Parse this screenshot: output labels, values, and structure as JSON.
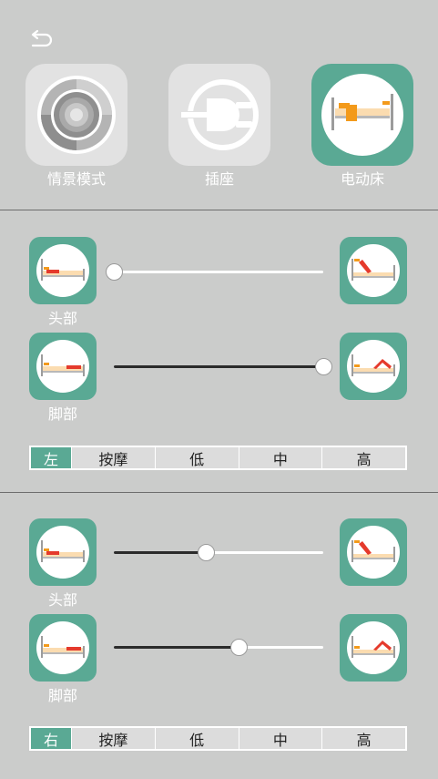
{
  "modes": [
    {
      "label": "情景模式",
      "icon": "scene-mode-icon",
      "active": false
    },
    {
      "label": "插座",
      "icon": "power-plug-icon",
      "active": false
    },
    {
      "label": "电动床",
      "icon": "electric-bed-icon",
      "active": true
    }
  ],
  "colors": {
    "accent": "#5aa994",
    "background": "#cbcccb",
    "tile": "#e2e2e2",
    "bed_red": "#e53a2c",
    "bed_orange": "#f39a1b"
  },
  "left": {
    "head": {
      "label": "头部",
      "level": 0.0
    },
    "foot": {
      "label": "脚部",
      "level": 1.0
    },
    "side_label": "左",
    "options": [
      "按摩",
      "低",
      "中",
      "高"
    ]
  },
  "right": {
    "head": {
      "label": "头部",
      "level": 0.44
    },
    "foot": {
      "label": "脚部",
      "level": 0.595
    },
    "side_label": "右",
    "options": [
      "按摩",
      "低",
      "中",
      "高"
    ]
  }
}
